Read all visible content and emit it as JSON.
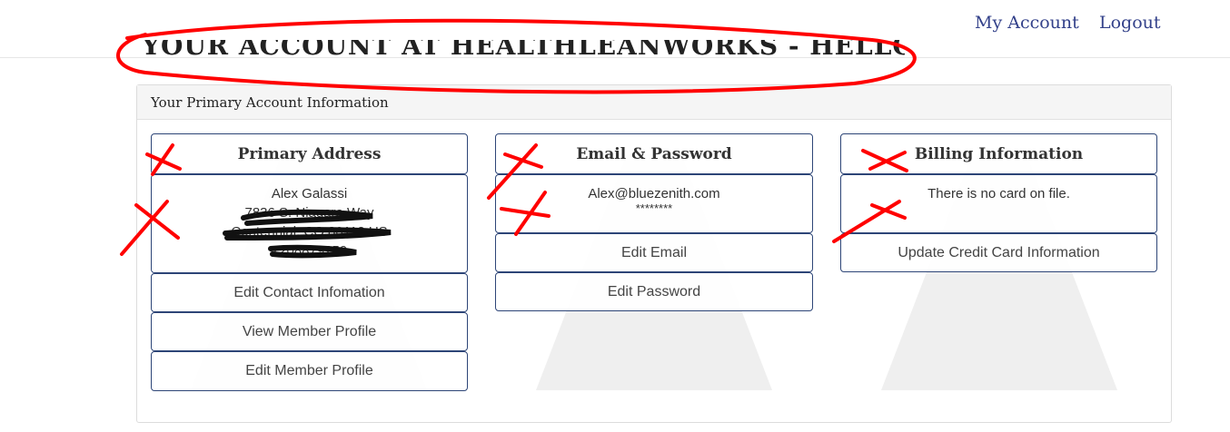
{
  "nav": {
    "my_account": "My Account",
    "logout": "Logout"
  },
  "page": {
    "heading": "YOUR ACCOUNT AT HEALTHLEANWORKS - HELLO ALEX"
  },
  "panel": {
    "title": "Your Primary Account Information"
  },
  "primary_address": {
    "title": "Primary Address",
    "name": "Alex Galassi",
    "street": "7836 S. Niagara Way",
    "city": "Centennial, CO 80112 US",
    "phone": "7208879259",
    "buttons": [
      "Edit Contact Infomation",
      "View Member Profile",
      "Edit Member Profile"
    ]
  },
  "email_password": {
    "title": "Email & Password",
    "email": "Alex@bluezenith.com",
    "password_mask": "********",
    "buttons": [
      "Edit Email",
      "Edit Password"
    ]
  },
  "billing": {
    "title": "Billing Information",
    "message": "There is no card on file.",
    "buttons": [
      "Update Credit Card Information"
    ]
  },
  "colors": {
    "accent": "#33418a",
    "border": "#2d4577",
    "annotation": "#ff0000",
    "scribble": "#111111"
  }
}
